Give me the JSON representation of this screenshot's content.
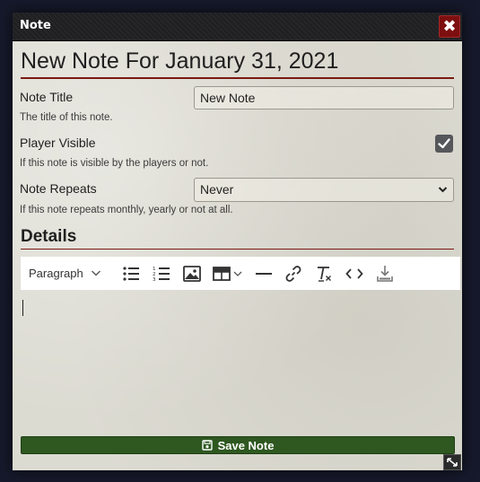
{
  "window": {
    "title": "Note",
    "close_icon": "close-icon",
    "close_label": "✖"
  },
  "header": {
    "heading": "New Note For January 31, 2021"
  },
  "fields": {
    "note_title": {
      "label": "Note Title",
      "value": "New Note",
      "hint": "The title of this note."
    },
    "player_visible": {
      "label": "Player Visible",
      "checked": true,
      "hint": "If this note is visible by the players or not."
    },
    "note_repeats": {
      "label": "Note Repeats",
      "selected": "Never",
      "hint": "If this note repeats monthly, yearly or not at all."
    }
  },
  "details": {
    "heading": "Details",
    "toolbar": {
      "paragraph_label": "Paragraph",
      "icons": [
        "chevron-down-icon",
        "bulleted-list-icon",
        "numbered-list-icon",
        "image-icon",
        "table-icon",
        "horizontal-rule-icon",
        "link-icon",
        "clear-format-icon",
        "code-icon",
        "download-icon"
      ]
    }
  },
  "actions": {
    "save_label": "Save Note",
    "save_icon": "save-icon"
  },
  "colors": {
    "accent_red": "#7a1a12",
    "save_green": "#2e5820",
    "close_red": "#7d0f10"
  }
}
